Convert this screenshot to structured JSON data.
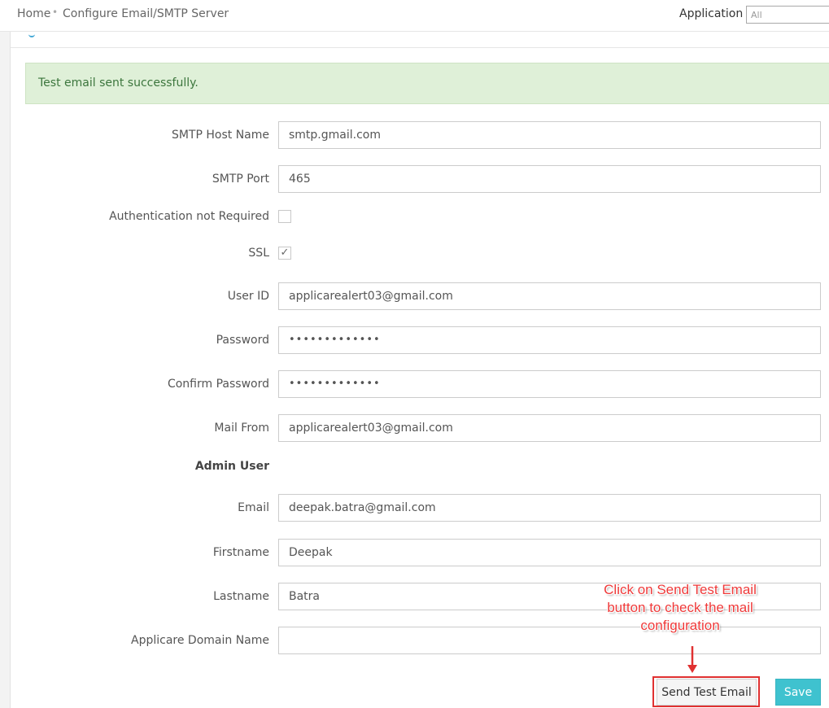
{
  "breadcrumb": {
    "home": "Home",
    "separator": "•",
    "current": "Configure Email/SMTP Server"
  },
  "application_filter": {
    "label": "Application",
    "value": "All"
  },
  "alert": {
    "message": "Test email sent successfully."
  },
  "form": {
    "smtp_host": {
      "label": "SMTP Host Name",
      "value": "smtp.gmail.com"
    },
    "smtp_port": {
      "label": "SMTP Port",
      "value": "465"
    },
    "auth_not_required": {
      "label": "Authentication not Required",
      "checked": false
    },
    "ssl": {
      "label": "SSL",
      "checked": true,
      "mark": "✓"
    },
    "user_id": {
      "label": "User ID",
      "value": "applicarealert03@gmail.com"
    },
    "password": {
      "label": "Password",
      "value": "•••••••••••••"
    },
    "confirm_password": {
      "label": "Confirm Password",
      "value": "•••••••••••••"
    },
    "mail_from": {
      "label": "Mail From",
      "value": "applicarealert03@gmail.com"
    },
    "admin_section": "Admin User",
    "email": {
      "label": "Email",
      "value": "deepak.batra@gmail.com"
    },
    "firstname": {
      "label": "Firstname",
      "value": "Deepak"
    },
    "lastname": {
      "label": "Lastname",
      "value": "Batra"
    },
    "domain_name": {
      "label": "Applicare Domain Name",
      "value": ""
    }
  },
  "buttons": {
    "send_test_email": "Send Test Email",
    "save": "Save"
  },
  "annotation": {
    "line1": "Click on Send Test Email",
    "line2": "button to check the mail",
    "line3": "configuration"
  },
  "colors": {
    "alert_bg": "#dff0d8",
    "alert_text": "#3c763d",
    "save_button": "#3fc2cf",
    "annotation_red": "#e03131"
  }
}
